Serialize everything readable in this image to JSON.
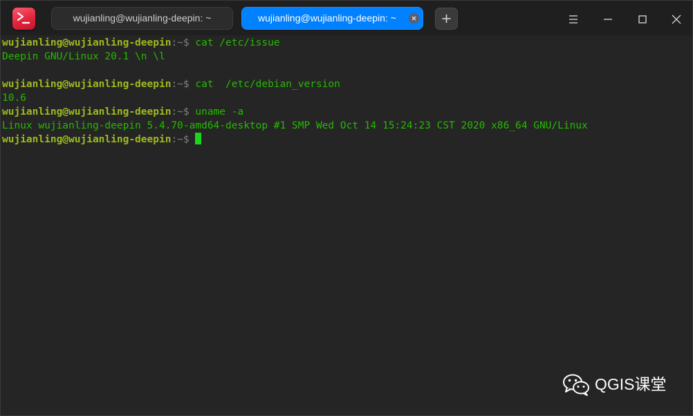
{
  "tabs": [
    {
      "title": "wujianling@wujianling-deepin: ~",
      "active": false
    },
    {
      "title": "wujianling@wujianling-deepin: ~",
      "active": true
    }
  ],
  "icons": {
    "app": "terminal-app-icon",
    "tab_close": "close-icon",
    "new_tab": "plus-icon",
    "menu": "hamburger-menu-icon",
    "minimize": "minimize-icon",
    "maximize": "maximize-icon",
    "close": "close-icon"
  },
  "terminal": {
    "lines": [
      {
        "user": "wujianling@wujianling-deepin",
        "rest": ":~$ ",
        "cmd": "cat /etc/issue"
      },
      {
        "output": "Deepin GNU/Linux 20.1 \\n \\l"
      },
      {
        "output": ""
      },
      {
        "user": "wujianling@wujianling-deepin",
        "rest": ":~$ ",
        "cmd": "cat  /etc/debian_version"
      },
      {
        "output": "10.6"
      },
      {
        "user": "wujianling@wujianling-deepin",
        "rest": ":~$ ",
        "cmd": "uname -a"
      },
      {
        "output": "Linux wujianling-deepin 5.4.70-amd64-desktop #1 SMP Wed Oct 14 15:24:23 CST 2020 x86_64 GNU/Linux"
      },
      {
        "user": "wujianling@wujianling-deepin",
        "rest": ":~$ ",
        "cmd": ""
      }
    ]
  },
  "watermark": {
    "text": "QGIS课堂",
    "icon": "wechat-icon"
  },
  "colors": {
    "background": "#252525",
    "titlebar": "#1f1f1f",
    "active_tab": "#0081ff",
    "prompt_user": "#9dbb1e",
    "terminal_text": "#27b900",
    "cursor": "#19d61b"
  }
}
